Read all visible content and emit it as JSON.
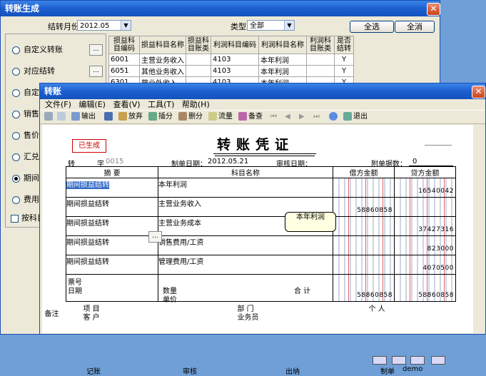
{
  "back_window": {
    "title": "转账生成",
    "month_label": "结转月份",
    "month_value": "2012.05",
    "type_label": "类型",
    "type_value": "全部",
    "select_all": "全选",
    "select_none": "全消",
    "options": [
      {
        "label": "自定义转账",
        "selected": false,
        "has_button": true
      },
      {
        "label": "对应结转",
        "selected": false,
        "has_button": true
      },
      {
        "label": "自定义比例结转",
        "selected": false,
        "has_button": false
      },
      {
        "label": "销售成本结转",
        "selected": false,
        "has_button": false
      },
      {
        "label": "售价（计划价）销售成本结转",
        "selected": false,
        "has_button": false
      },
      {
        "label": "汇兑损益结转",
        "selected": false,
        "has_button": false
      },
      {
        "label": "期间损益结转",
        "selected": true,
        "has_button": false
      },
      {
        "label": "费用摊销与预提",
        "selected": false,
        "has_button": false
      }
    ],
    "dots": "...",
    "checkbox_label": "按科目",
    "table": {
      "headers": [
        "损益科目编码",
        "损益科目名称",
        "损益科目账类",
        "利润科目编码",
        "利润科目名称",
        "利润科目账类",
        "是否结转"
      ],
      "rows": [
        [
          "6001",
          "主营业务收入",
          "",
          "4103",
          "本年利润",
          "",
          "Y"
        ],
        [
          "6051",
          "其他业务收入",
          "",
          "4103",
          "本年利润",
          "",
          "Y"
        ],
        [
          "6301",
          "营业外收入",
          "",
          "4103",
          "本年利润",
          "",
          "Y"
        ]
      ]
    }
  },
  "front_window": {
    "title": "转账",
    "menu": [
      "文件(F)",
      "编辑(E)",
      "查看(V)",
      "工具(T)",
      "帮助(H)"
    ],
    "toolbar": [
      "输出",
      "放弃",
      "插分",
      "删分",
      "流量",
      "备查",
      "退出"
    ],
    "stamp": "已生成",
    "voucher_title": "转账凭证",
    "zhuan": "转",
    "zi_label": "字",
    "voucher_no": "0015",
    "date_label": "制单日期：",
    "date_value": "2012.05.21",
    "audit_label": "审核日期：",
    "attach_label": "附单据数：",
    "attach_value": "0",
    "col_summary": "摘 要",
    "col_account": "科目名称",
    "col_debit": "借方金额",
    "col_credit": "贷方金额",
    "entries": [
      {
        "summary": "期间损益结转",
        "account": "本年利润",
        "debit": "",
        "credit": "16540042"
      },
      {
        "summary": "期间损益结转",
        "account": "主营业务收入",
        "debit": "58860858",
        "credit": ""
      },
      {
        "summary": "期间损益结转",
        "account": "主营业务成本",
        "debit": "",
        "credit": "37427316"
      },
      {
        "summary": "期间损益结转",
        "account": "销售费用/工资",
        "debit": "",
        "credit": "823000"
      },
      {
        "summary": "期间损益结转",
        "account": "管理费用/工资",
        "debit": "",
        "credit": "4070500"
      }
    ],
    "tooltip": "本年利润",
    "ticket_label": "票号",
    "date_row_label": "日期",
    "qty_label": "数量",
    "price_label": "单价",
    "total_label": "合 计",
    "total_debit": "58860858",
    "total_credit": "58860858",
    "remark_label": "备注",
    "project_label": "项  目",
    "customer_label": "客  户",
    "dept_label": "部  门",
    "salesman_label": "业务员",
    "person_label": "个  人",
    "footer": {
      "bookkeep": "记账",
      "audit": "审核",
      "cashier": "出纳",
      "maker": "制单",
      "maker_value": "demo"
    }
  }
}
